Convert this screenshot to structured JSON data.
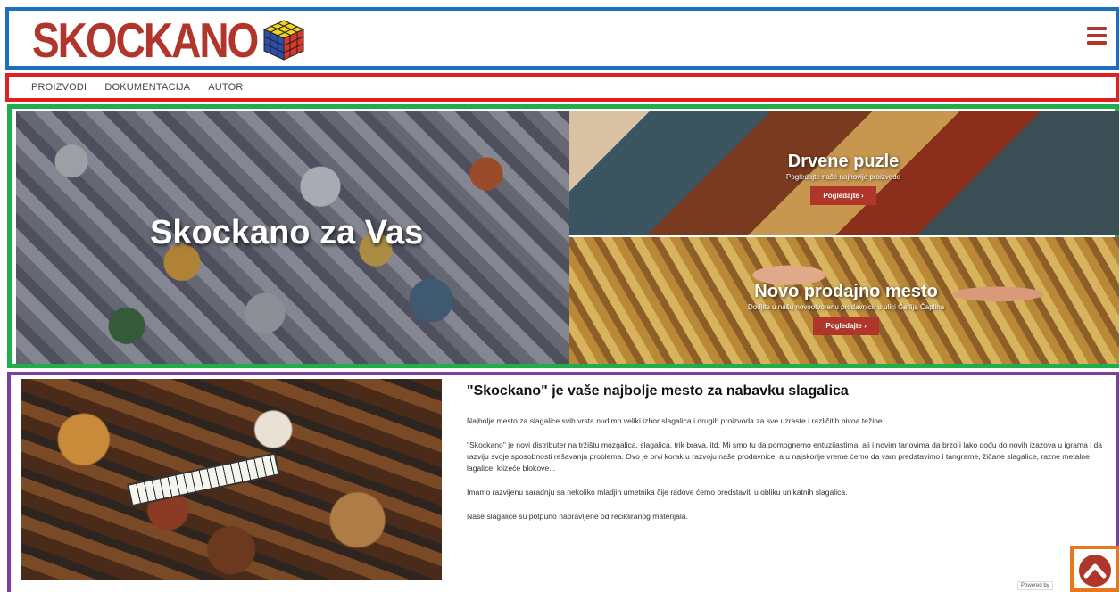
{
  "header": {
    "logo_text": "SKOCKANO",
    "menu_icon": "hamburger-menu-icon",
    "brand_color": "#b0352a"
  },
  "nav": {
    "items": [
      {
        "label": "PROIZVODI"
      },
      {
        "label": "DOKUMENTACIJA"
      },
      {
        "label": "AUTOR"
      }
    ]
  },
  "hero": {
    "main_title": "Skockano za Vas",
    "panels": [
      {
        "title": "Drvene puzle",
        "subtitle": "Pogledajte naše najnovije proizvode",
        "button_label": "Pogledajte ›"
      },
      {
        "title": "Novo prodajno mesto",
        "subtitle": "Dodjite u našu novootvorenu prodavnicu u ulici Čarlija Čaplina",
        "button_label": "Pogledajte ›"
      }
    ]
  },
  "content": {
    "heading": "\"Skockano\" je vaše najbolje mesto za nabavku slagalica",
    "paragraphs": [
      "Najbolje mesto za slagalice svih vrsta nudimo veliki izbor slagalica i drugih proizvoda za sve uzraste i različitih nivoa težine.",
      "\"Skockano\" je novi distributer na tržištu mozgalica, slagalica, trik brava, itd. Mi smo tu da pomognemo entuzijastima, ali i novim fanovima da brzo i lako dođu do novih izazova u igrama i da razviju svoje sposobnosti rešavanja problema. Ovo je prvi korak u razvoju naše prodavnice, a u najskorije vreme ćemo da vam predstavimo i tangrame, žičane slagalice, razne metalne lagalice, klizeće blokove...",
      "Imamo razvijenu saradnju sa nekoliko mladjih umetnika čije radove ćemo predstaviti u obliku unikatnih slagalica.",
      "Naše slagalice su potpuno napravljene od recikliranog materijala."
    ]
  },
  "footer": {
    "powered_text": "Powered by",
    "back_to_top_icon": "chevron-up-icon"
  }
}
